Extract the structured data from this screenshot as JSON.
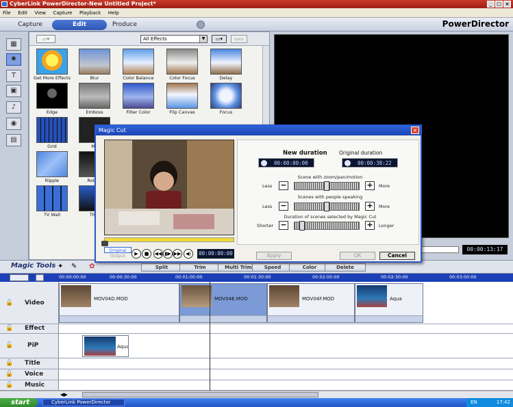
{
  "window": {
    "title": "CyberLink PowerDirector-New Untitled Project*"
  },
  "menu": [
    "File",
    "Edit",
    "View",
    "Capture",
    "Playback",
    "Help"
  ],
  "modes": {
    "capture": "Capture",
    "edit": "Edit",
    "produce": "Produce",
    "brand": "PowerDirector"
  },
  "library": {
    "filter_select": "All Effects",
    "effects": [
      {
        "label": "Get More Effects"
      },
      {
        "label": "Blur"
      },
      {
        "label": "Color Balance"
      },
      {
        "label": "Color Focus"
      },
      {
        "label": "Delay"
      },
      {
        "label": "Edge"
      },
      {
        "label": "Emboss"
      },
      {
        "label": "Filter Color"
      },
      {
        "label": "Flip Canvas"
      },
      {
        "label": "Focus"
      },
      {
        "label": "Grid"
      },
      {
        "label": "Mo"
      },
      {
        "label": "Ripple"
      },
      {
        "label": "Rotate"
      },
      {
        "label": "TV Wall"
      },
      {
        "label": "Thre"
      }
    ]
  },
  "preview": {
    "timecode": "00:00:13:17"
  },
  "magic_tools": {
    "label": "Magic Tools",
    "buttons": [
      "Split",
      "Trim",
      "Multi Trim",
      "Speed",
      "Color",
      "Delete"
    ]
  },
  "timeline": {
    "ruler": [
      "00:00:00:00",
      "00:00:30:00",
      "00:01:00:00",
      "00:01:30:00",
      "00:02:00:00",
      "00:02:30:00",
      "00:03:00:00"
    ],
    "tracks": [
      "Video",
      "Effect",
      "PiP",
      "Title",
      "Voice",
      "Music"
    ],
    "video_clips": [
      "MOV04D.MOD",
      "MOV04E.MOD",
      "MOV04F.MOD",
      "Aqua"
    ],
    "pip_clips": [
      "Aqua"
    ]
  },
  "dialog": {
    "title": "Magic Cut",
    "new_duration_label": "New duration",
    "new_duration": "00:00:00:00",
    "original_duration_label": "Original duration",
    "original_duration": "00:00:38:22",
    "sliders": [
      {
        "label": "Scene with zoom/pan/motion",
        "less": "Less",
        "more": "More",
        "value": 0.5
      },
      {
        "label": "Scenes with people speaking",
        "less": "Less",
        "more": "More",
        "value": 0.5
      },
      {
        "label": "Duration of scenes selected by Magic Cut",
        "less": "Shorter",
        "more": "Longer",
        "value": 0.08
      }
    ],
    "original_tab": "Original",
    "output_tab": "Output",
    "timecode": "00:00:00:00",
    "apply": "Apply",
    "ok": "OK",
    "cancel": "Cancel"
  },
  "taskbar": {
    "start": "start",
    "app": "CyberLink PowerDirector",
    "lang": "EN",
    "clock": "17:42"
  }
}
